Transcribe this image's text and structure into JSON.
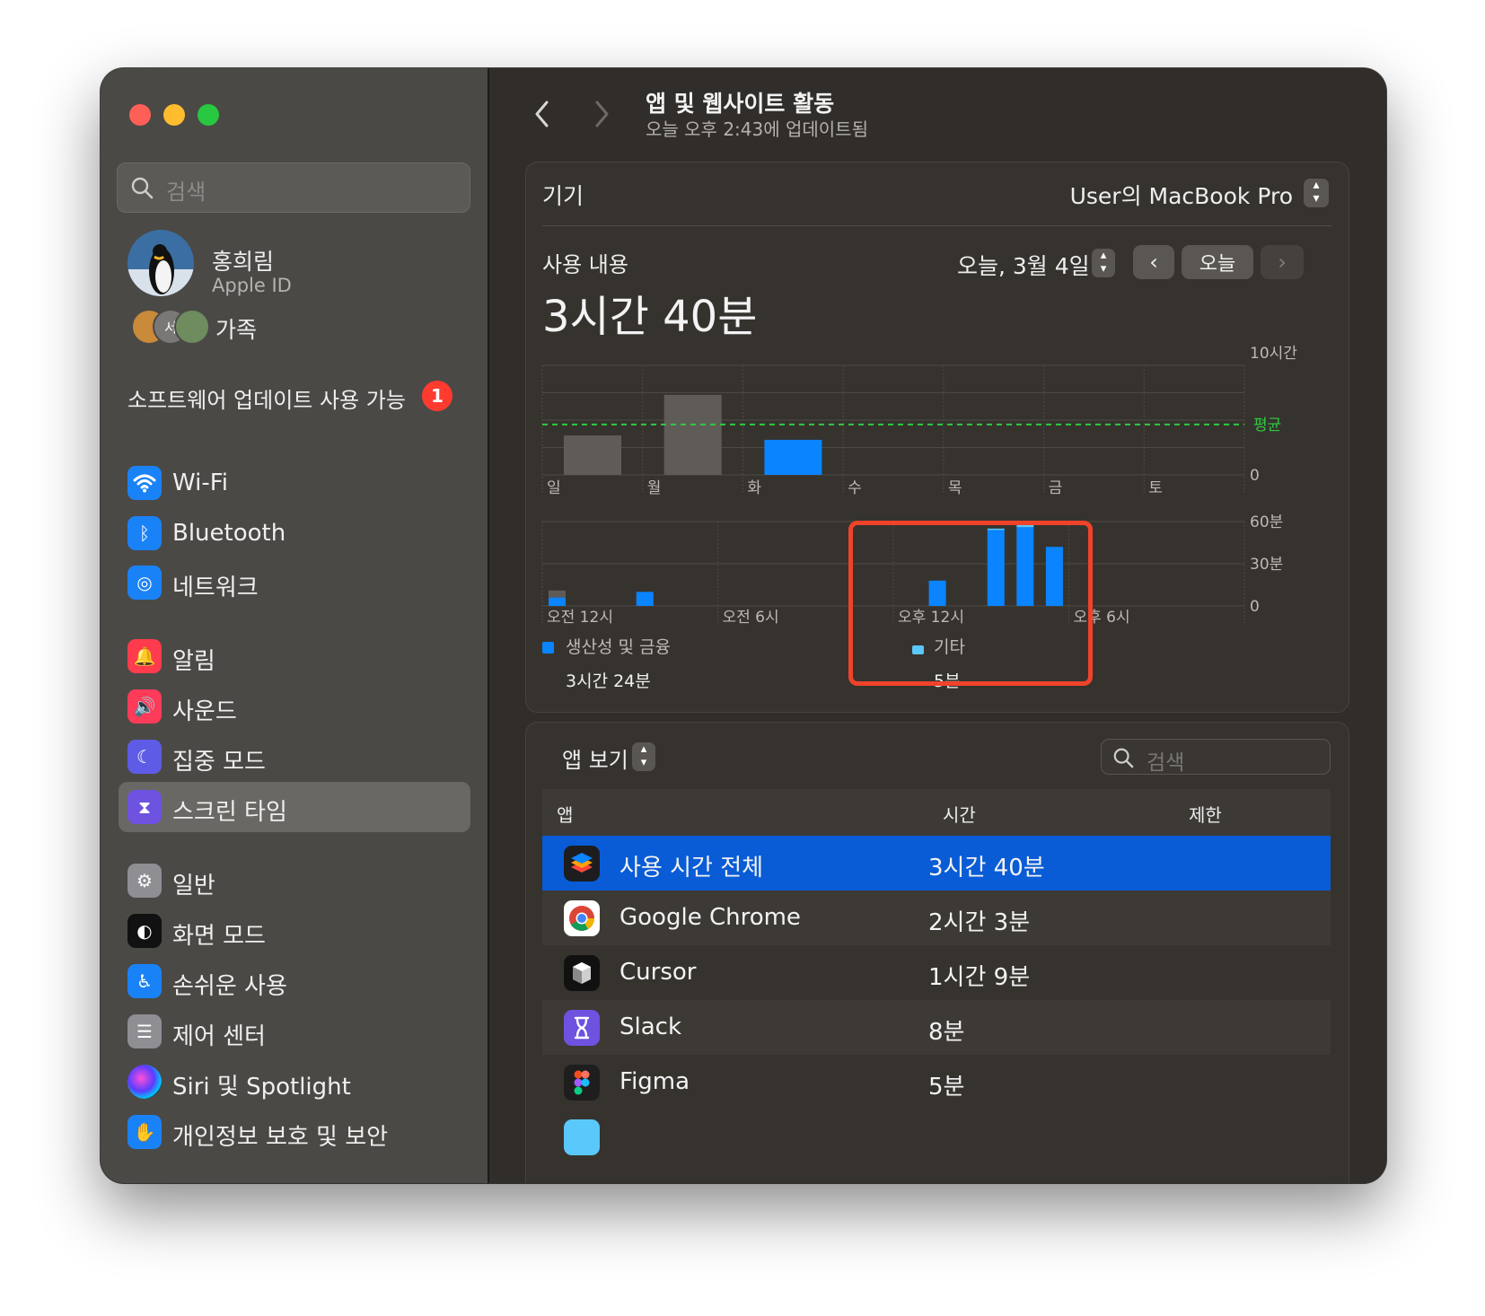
{
  "window": {
    "title": "앱 및 웹사이트 활동",
    "subtitle": "오늘 오후 2:43에 업데이트됨"
  },
  "sidebar": {
    "search_placeholder": "검색",
    "profile": {
      "name": "홍희림",
      "sub": "Apple ID"
    },
    "family": {
      "label": "가족",
      "avatar_text": "서"
    },
    "update": {
      "label": "소프트웨어 업데이트 사용 가능",
      "count": "1"
    },
    "items": [
      {
        "label": "Wi-Fi",
        "icon": "wifi-icon",
        "color": "#1a82f7"
      },
      {
        "label": "Bluetooth",
        "icon": "bluetooth-icon",
        "color": "#1a82f7"
      },
      {
        "label": "네트워크",
        "icon": "globe-icon",
        "color": "#1a82f7"
      },
      {
        "label": "알림",
        "icon": "bell-icon",
        "color": "#ff3b4e"
      },
      {
        "label": "사운드",
        "icon": "speaker-icon",
        "color": "#ff3b5a"
      },
      {
        "label": "집중 모드",
        "icon": "moon-icon",
        "color": "#5e5ce6"
      },
      {
        "label": "스크린 타임",
        "icon": "hourglass-icon",
        "color": "#6e52e0"
      },
      {
        "label": "일반",
        "icon": "gear-icon",
        "color": "#8e8e93"
      },
      {
        "label": "화면 모드",
        "icon": "appearance-icon",
        "color": "#111111"
      },
      {
        "label": "손쉬운 사용",
        "icon": "accessibility-icon",
        "color": "#1a82f7"
      },
      {
        "label": "제어 센터",
        "icon": "toggles-icon",
        "color": "#8e8e93"
      },
      {
        "label": "Siri 및 Spotlight",
        "icon": "siri-icon",
        "color": "#333333"
      },
      {
        "label": "개인정보 보호 및 보안",
        "icon": "hand-icon",
        "color": "#1a82f7"
      }
    ]
  },
  "device": {
    "label": "기기",
    "value": "User의 MacBook Pro"
  },
  "usage": {
    "label": "사용 내용",
    "total": "3시간 40분",
    "date": "오늘, 3월 4일",
    "today_button": "오늘"
  },
  "chart_data": [
    {
      "type": "bar",
      "categories": [
        "일",
        "월",
        "화",
        "수",
        "목",
        "금",
        "토"
      ],
      "values": [
        3.6,
        7.3,
        3.2,
        0,
        0,
        0,
        0
      ],
      "highlight_index": 2,
      "ylim": [
        0,
        10
      ],
      "yticks": [
        "10시간",
        "0"
      ],
      "average_label": "평균",
      "average_value": 4.6
    },
    {
      "type": "bar",
      "x_ticks": [
        "오전 12시",
        "오전 6시",
        "오후 12시",
        "오후 6시"
      ],
      "ylim": [
        0,
        60
      ],
      "yticks": [
        "60분",
        "30분",
        "0"
      ],
      "series": [
        {
          "name": "생산성 및 금융",
          "hours": [
            0,
            3,
            13,
            15,
            16,
            17
          ],
          "values": [
            6,
            10,
            18,
            54,
            56,
            42
          ]
        },
        {
          "name": "기타",
          "hours": [
            0,
            3,
            13,
            15,
            16,
            17
          ],
          "values": [
            5,
            0,
            0,
            1,
            3,
            0
          ]
        }
      ],
      "totals": [
        "3시간 24분",
        "5분"
      ]
    }
  ],
  "apps": {
    "view_label": "앱 보기",
    "search_placeholder": "검색",
    "columns": [
      "앱",
      "시간",
      "제한"
    ],
    "rows": [
      {
        "name": "사용 시간 전체",
        "time": "3시간 40분",
        "icon": "stack-icon"
      },
      {
        "name": "Google Chrome",
        "time": "2시간 3분",
        "icon": "chrome-icon"
      },
      {
        "name": "Cursor",
        "time": "1시간 9분",
        "icon": "cursor-app-icon"
      },
      {
        "name": "Slack",
        "time": "8분",
        "icon": "hourglass-icon"
      },
      {
        "name": "Figma",
        "time": "5분",
        "icon": "figma-icon"
      }
    ]
  },
  "colors": {
    "accent": "#0a84ff",
    "selection": "#0a5cd6",
    "average_line": "#2ecc40",
    "highlight_box": "#f0432a",
    "other_category": "#5ac8fa"
  }
}
